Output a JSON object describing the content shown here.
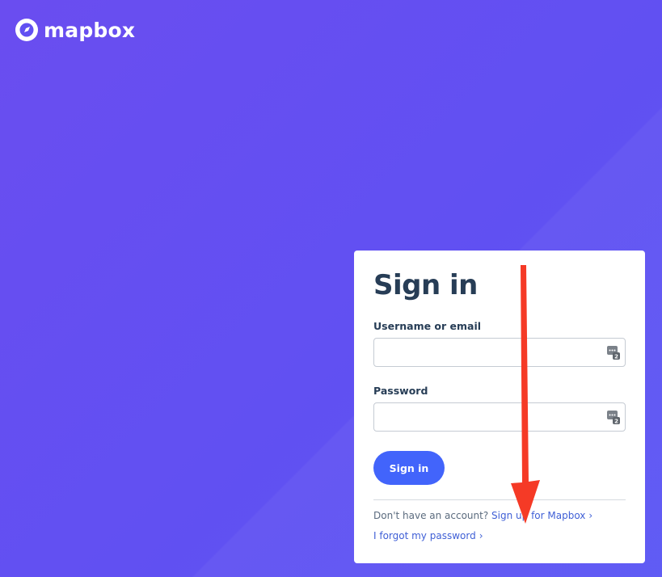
{
  "brand": {
    "name": "mapbox"
  },
  "signin": {
    "title": "Sign in",
    "username_label": "Username or email",
    "username_value": "",
    "password_label": "Password",
    "password_value": "",
    "submit_label": "Sign in",
    "no_account_text": "Don't have an account?",
    "signup_link": "Sign up for Mapbox",
    "forgot_link": "I forgot my password"
  },
  "colors": {
    "background": "#6150f2",
    "primary_button": "#4264fb",
    "link": "#3f5fd6",
    "annotation_arrow": "#f53a26"
  }
}
